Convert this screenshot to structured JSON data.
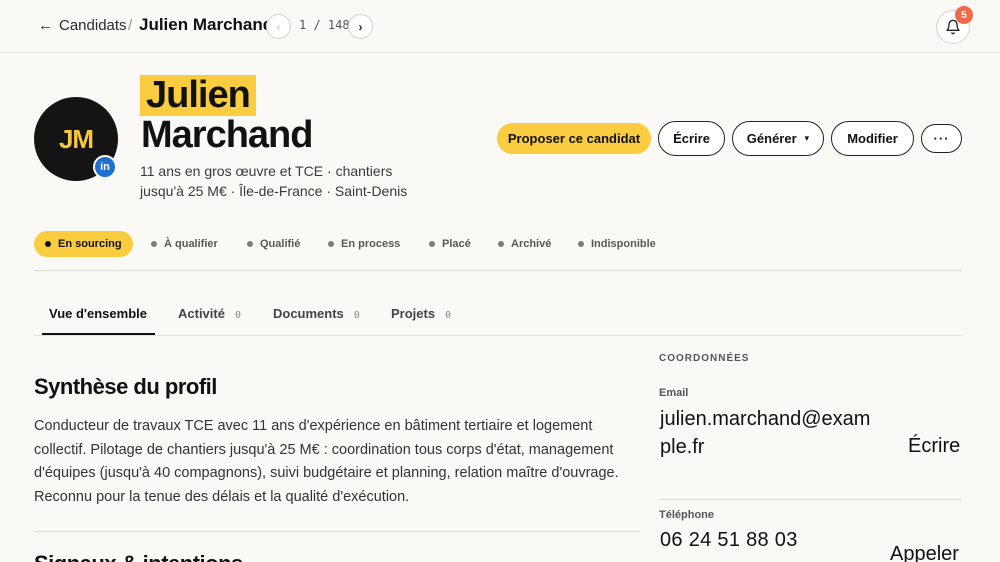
{
  "nav": {
    "back_label": "Candidats",
    "separator": "/",
    "current": "Julien Marchand",
    "pager_text": "1 / 148",
    "prev_glyph": "‹",
    "next_glyph": "›",
    "notifications_count": "5"
  },
  "profile": {
    "initials": "JM",
    "linkedin_label": "in",
    "first_name": "Julien",
    "last_name": "Marchand",
    "tagline_line1": "11 ans en gros œuvre et TCE · chantiers",
    "tagline_line2": "jusqu'à 25 M€ · Île-de-France · Saint-Denis"
  },
  "actions": {
    "propose": "Proposer ce candidat",
    "write": "Écrire",
    "generate": "Générer",
    "generate_caret": "▾",
    "edit": "Modifier",
    "more": "···"
  },
  "statuses": [
    "En sourcing",
    "À qualifier",
    "Qualifié",
    "En process",
    "Placé",
    "Archivé",
    "Indisponible"
  ],
  "tabs": [
    {
      "label": "Vue d'ensemble",
      "count": ""
    },
    {
      "label": "Activité",
      "count": "0"
    },
    {
      "label": "Documents",
      "count": "0"
    },
    {
      "label": "Projets",
      "count": "0"
    }
  ],
  "summary": {
    "title": "Synthèse du profil",
    "text": "Conducteur de travaux TCE avec 11 ans d'expérience en bâtiment tertiaire et logement collectif. Pilotage de chantiers jusqu'à 25 M€ : coordination tous corps d'état, management d'équipes (jusqu'à 40 compagnons), suivi budgétaire et planning, relation maître d'ouvrage. Reconnu pour la tenue des délais et la qualité d'exécution.",
    "next_section_title": "Signaux & intentions"
  },
  "contact": {
    "section_label": "COORDONNÉES",
    "email_label": "Email",
    "email_value": "julien.marchand@example.fr",
    "email_action": "Écrire",
    "phone_label": "Téléphone",
    "phone_value": "06 24 51 88 03",
    "phone_action": "Appeler"
  },
  "colors": {
    "accent": "#f9cd3f",
    "badge": "#f06a4a",
    "linkedin": "#1e6fd0",
    "background": "#faf9f6"
  }
}
